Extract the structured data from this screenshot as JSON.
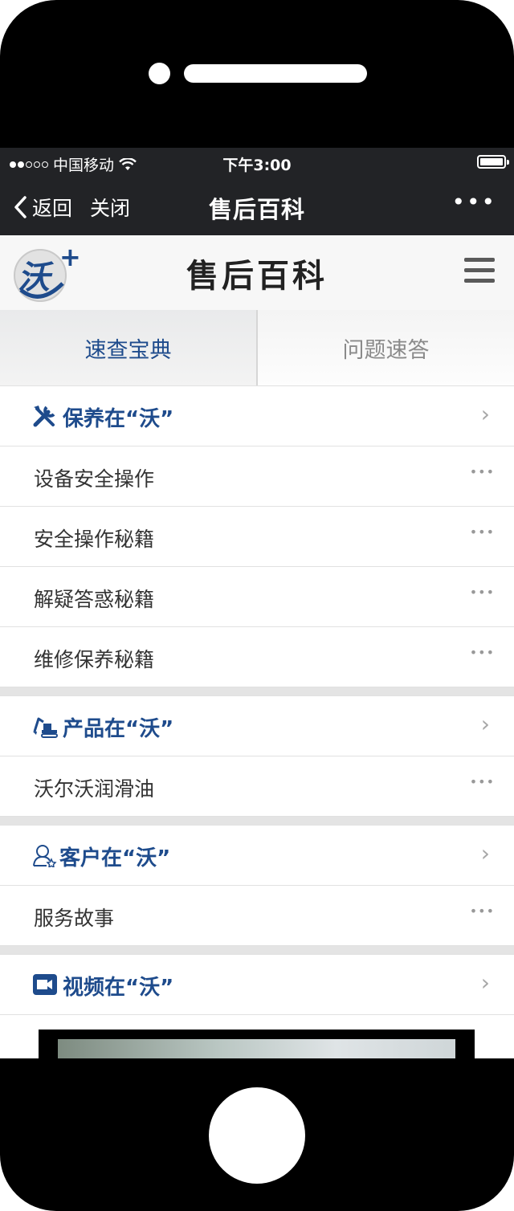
{
  "status_bar": {
    "carrier": "中国移动",
    "time": "下午3:00"
  },
  "nav_bar": {
    "back_label": "返回",
    "close_label": "关闭",
    "title": "售后百科",
    "more_label": "•••"
  },
  "app_header": {
    "title": "售后百科",
    "logo_text": "沃+"
  },
  "tabs": [
    {
      "label": "速查宝典",
      "active": true
    },
    {
      "label": "问题速答",
      "active": false
    }
  ],
  "sections": [
    {
      "title": "保养在“沃”",
      "icon": "wrench-screwdriver-icon",
      "items": [
        "设备安全操作",
        "安全操作秘籍",
        "解疑答惑秘籍",
        "维修保养秘籍"
      ]
    },
    {
      "title": "产品在“沃”",
      "icon": "excavator-icon",
      "items": [
        "沃尔沃润滑油"
      ]
    },
    {
      "title": "客户在“沃”",
      "icon": "user-icon",
      "items": [
        "服务故事"
      ]
    },
    {
      "title": "视频在“沃”",
      "icon": "video-camera-icon",
      "items": []
    }
  ],
  "colors": {
    "accent": "#1e4b8c",
    "bar_bg": "#222326"
  }
}
